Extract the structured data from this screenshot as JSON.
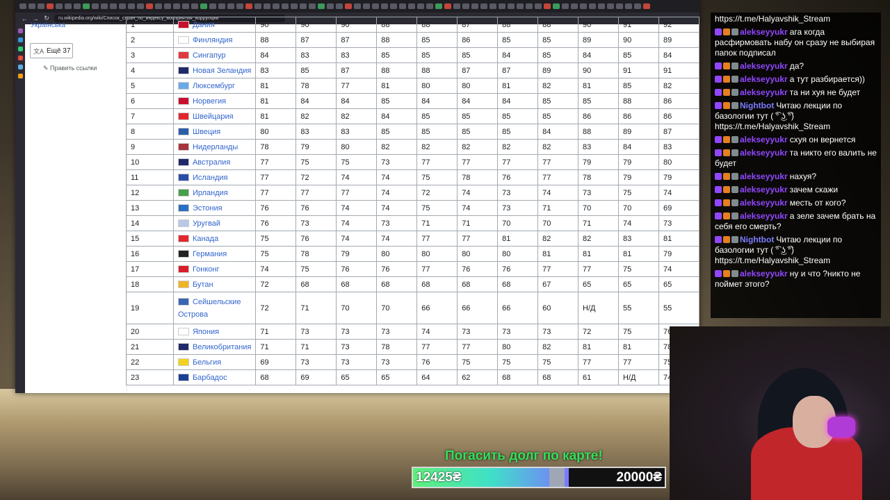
{
  "browser": {
    "url": "ru.wikipedia.org/wiki/Список_стран_по_индексу_восприятия_коррупции",
    "nav_back": "←",
    "nav_forward": "→",
    "nav_reload": "↻"
  },
  "wiki_sidebar": {
    "lang_top": "Українська",
    "more_langs": "Ещё 37",
    "more_icon": "translate-icon",
    "edit_links": "✎ Править ссылки"
  },
  "table": {
    "partial_top": {
      "rank": "1",
      "country": "Дания",
      "values": [
        "90",
        "90",
        "90",
        "88",
        "88",
        "87",
        "88",
        "88",
        "90",
        "91",
        "92"
      ]
    },
    "rows": [
      {
        "rank": "2",
        "country": "Финляндия",
        "flag": "#ffffff",
        "values": [
          "88",
          "87",
          "87",
          "88",
          "85",
          "86",
          "85",
          "85",
          "89",
          "90",
          "89"
        ]
      },
      {
        "rank": "3",
        "country": "Сингапур",
        "flag": "#e03a3e",
        "values": [
          "84",
          "83",
          "83",
          "85",
          "85",
          "85",
          "84",
          "85",
          "84",
          "85",
          "84"
        ]
      },
      {
        "rank": "4",
        "country": "Новая Зеландия",
        "flag": "#1f2a6b",
        "values": [
          "83",
          "85",
          "87",
          "88",
          "88",
          "87",
          "87",
          "89",
          "90",
          "91",
          "91"
        ]
      },
      {
        "rank": "5",
        "country": "Люксембург",
        "flag": "#6aa9e8",
        "values": [
          "81",
          "78",
          "77",
          "81",
          "80",
          "80",
          "81",
          "82",
          "81",
          "85",
          "82"
        ]
      },
      {
        "rank": "6",
        "country": "Норвегия",
        "flag": "#c8102e",
        "values": [
          "81",
          "84",
          "84",
          "85",
          "84",
          "84",
          "84",
          "85",
          "85",
          "88",
          "86"
        ]
      },
      {
        "rank": "7",
        "country": "Швейцария",
        "flag": "#e3262c",
        "values": [
          "81",
          "82",
          "82",
          "84",
          "85",
          "85",
          "85",
          "85",
          "86",
          "86",
          "86"
        ]
      },
      {
        "rank": "8",
        "country": "Швеция",
        "flag": "#2a5ea8",
        "values": [
          "80",
          "83",
          "83",
          "85",
          "85",
          "85",
          "85",
          "84",
          "88",
          "89",
          "87"
        ]
      },
      {
        "rank": "9",
        "country": "Нидерланды",
        "flag": "#a6343d",
        "values": [
          "78",
          "79",
          "80",
          "82",
          "82",
          "82",
          "82",
          "82",
          "83",
          "84",
          "83"
        ]
      },
      {
        "rank": "10",
        "country": "Австралия",
        "flag": "#1f2a6b",
        "values": [
          "77",
          "75",
          "75",
          "73",
          "77",
          "77",
          "77",
          "77",
          "79",
          "79",
          "80"
        ]
      },
      {
        "rank": "11",
        "country": "Исландия",
        "flag": "#2a4ea8",
        "values": [
          "77",
          "72",
          "74",
          "74",
          "75",
          "78",
          "76",
          "77",
          "78",
          "79",
          "79"
        ]
      },
      {
        "rank": "12",
        "country": "Ирландия",
        "flag": "#46a04b",
        "values": [
          "77",
          "77",
          "77",
          "74",
          "72",
          "74",
          "73",
          "74",
          "73",
          "75",
          "74"
        ]
      },
      {
        "rank": "13",
        "country": "Эстония",
        "flag": "#2b6ec5",
        "values": [
          "76",
          "76",
          "74",
          "74",
          "75",
          "74",
          "73",
          "71",
          "70",
          "70",
          "69"
        ]
      },
      {
        "rank": "14",
        "country": "Уругвай",
        "flag": "#b8c8e8",
        "values": [
          "76",
          "73",
          "74",
          "73",
          "71",
          "71",
          "70",
          "70",
          "71",
          "74",
          "73"
        ]
      },
      {
        "rank": "15",
        "country": "Канада",
        "flag": "#e3262c",
        "values": [
          "75",
          "76",
          "74",
          "74",
          "77",
          "77",
          "81",
          "82",
          "82",
          "83",
          "81"
        ]
      },
      {
        "rank": "16",
        "country": "Германия",
        "flag": "#222222",
        "values": [
          "75",
          "78",
          "79",
          "80",
          "80",
          "80",
          "80",
          "81",
          "81",
          "81",
          "79"
        ]
      },
      {
        "rank": "17",
        "country": "Гонконг",
        "flag": "#d81e2a",
        "values": [
          "74",
          "75",
          "76",
          "76",
          "77",
          "76",
          "76",
          "77",
          "77",
          "75",
          "74"
        ]
      },
      {
        "rank": "18",
        "country": "Бутан",
        "flag": "#f0b428",
        "values": [
          "72",
          "68",
          "68",
          "68",
          "68",
          "68",
          "68",
          "67",
          "65",
          "65",
          "65"
        ]
      },
      {
        "rank": "19",
        "country": "Сейшельские Острова",
        "flag": "#3b66b3",
        "values": [
          "72",
          "71",
          "70",
          "70",
          "66",
          "66",
          "66",
          "60",
          "Н/Д",
          "55",
          "55"
        ],
        "tall": true
      },
      {
        "rank": "20",
        "country": "Япония",
        "flag": "#ffffff",
        "values": [
          "71",
          "73",
          "73",
          "73",
          "74",
          "73",
          "73",
          "73",
          "72",
          "75",
          "76"
        ]
      },
      {
        "rank": "21",
        "country": "Великобритания",
        "flag": "#1f2a6b",
        "values": [
          "71",
          "71",
          "73",
          "78",
          "77",
          "77",
          "80",
          "82",
          "81",
          "81",
          "78"
        ]
      },
      {
        "rank": "22",
        "country": "Бельгия",
        "flag": "#f2d21e",
        "values": [
          "69",
          "73",
          "73",
          "73",
          "76",
          "75",
          "75",
          "75",
          "77",
          "77",
          "75"
        ]
      },
      {
        "rank": "23",
        "country": "Барбадос",
        "flag": "#1c3f94",
        "values": [
          "68",
          "69",
          "65",
          "65",
          "64",
          "62",
          "68",
          "68",
          "61",
          "Н/Д",
          "74"
        ]
      }
    ]
  },
  "chat": {
    "header": "https://t.me/Halyavshik_Stream",
    "messages": [
      {
        "user": "alekseyyukr",
        "color": "#9147ff",
        "text": "ага когда расфирмовать набу он сразу не выбирая папок подписал"
      },
      {
        "user": "alekseyyukr",
        "color": "#9147ff",
        "text": "да?"
      },
      {
        "user": "alekseyyukr",
        "color": "#9147ff",
        "text": "а тут разбирается))"
      },
      {
        "user": "alekseyyukr",
        "color": "#9147ff",
        "text": "та ни хуя не будет"
      },
      {
        "user": "Nightbot",
        "color": "#7c7cff",
        "text": "Читаю лекции по базологии тут ( ͡° ͜ʖ ͡°) https://t.me/Halyavshik_Stream"
      },
      {
        "user": "alekseyyukr",
        "color": "#9147ff",
        "text": "схуя он вернется"
      },
      {
        "user": "alekseyyukr",
        "color": "#9147ff",
        "text": "та никто его валить не будет"
      },
      {
        "user": "alekseyyukr",
        "color": "#9147ff",
        "text": "нахуя?"
      },
      {
        "user": "alekseyyukr",
        "color": "#9147ff",
        "text": "зачем скажи"
      },
      {
        "user": "alekseyyukr",
        "color": "#9147ff",
        "text": "месть от кого?"
      },
      {
        "user": "alekseyyukr",
        "color": "#9147ff",
        "text": "а зеле зачем брать на себя его смерть?"
      },
      {
        "user": "Nightbot",
        "color": "#7c7cff",
        "text": "Читаю лекции по базологии тут ( ͡° ͜ʖ ͡°) https://t.me/Halyavshik_Stream"
      },
      {
        "user": "alekseyyukr",
        "color": "#9147ff",
        "text": "ну и что ?никто не поймет этого?"
      }
    ]
  },
  "donation": {
    "title": "Погасить долг по карте!",
    "current": "12425₴",
    "goal": "20000₴",
    "progress": 0.62
  }
}
